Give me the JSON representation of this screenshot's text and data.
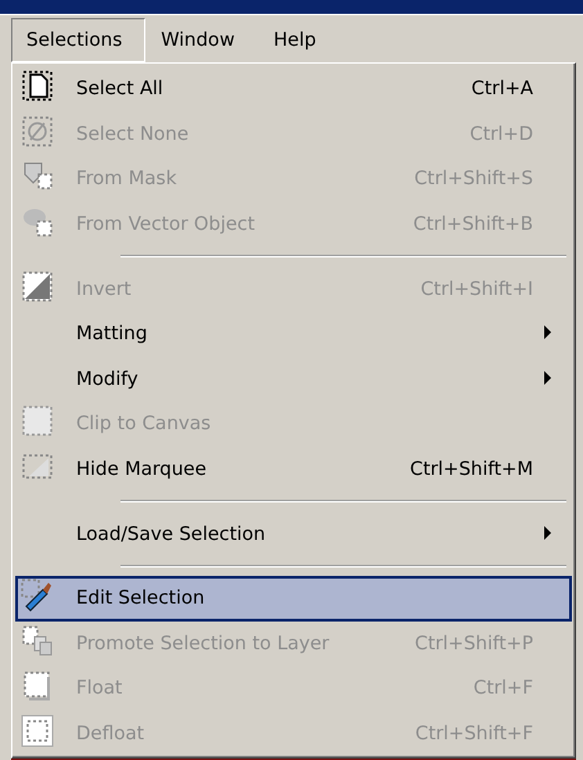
{
  "menu_bar": [
    {
      "label": "Selections",
      "selected": true
    },
    {
      "label": "Window",
      "selected": false
    },
    {
      "label": "Help",
      "selected": false
    }
  ],
  "menu": [
    {
      "kind": "command",
      "label": "Select All",
      "shortcut": "Ctrl+A",
      "disabled": false,
      "selected": false
    },
    {
      "kind": "command",
      "label": "Select None",
      "shortcut": "Ctrl+D",
      "disabled": true,
      "selected": false
    },
    {
      "kind": "command",
      "label": "From Mask",
      "shortcut": "Ctrl+Shift+S",
      "disabled": true,
      "selected": false
    },
    {
      "kind": "command",
      "label": "From Vector Object",
      "shortcut": "Ctrl+Shift+B",
      "disabled": true,
      "selected": false
    },
    {
      "kind": "separator"
    },
    {
      "kind": "command",
      "label": "Invert",
      "shortcut": "Ctrl+Shift+I",
      "disabled": true,
      "selected": false
    },
    {
      "kind": "submenu",
      "label": "Matting",
      "disabled": false,
      "selected": false
    },
    {
      "kind": "submenu",
      "label": "Modify",
      "disabled": false,
      "selected": false
    },
    {
      "kind": "command",
      "label": "Clip to Canvas",
      "disabled": true,
      "selected": false
    },
    {
      "kind": "command",
      "label": "Hide Marquee",
      "shortcut": "Ctrl+Shift+M",
      "disabled": false,
      "selected": false
    },
    {
      "kind": "separator"
    },
    {
      "kind": "submenu",
      "label": "Load/Save Selection",
      "disabled": false,
      "selected": false
    },
    {
      "kind": "separator"
    },
    {
      "kind": "command",
      "label": "Edit Selection",
      "disabled": false,
      "selected": true
    },
    {
      "kind": "command",
      "label": "Promote Selection to Layer",
      "shortcut": "Ctrl+Shift+P",
      "disabled": true,
      "selected": false
    },
    {
      "kind": "command",
      "label": "Float",
      "shortcut": "Ctrl+F",
      "disabled": true,
      "selected": false
    },
    {
      "kind": "command",
      "label": "Defloat",
      "shortcut": "Ctrl+Shift+F",
      "disabled": true,
      "selected": false
    }
  ]
}
